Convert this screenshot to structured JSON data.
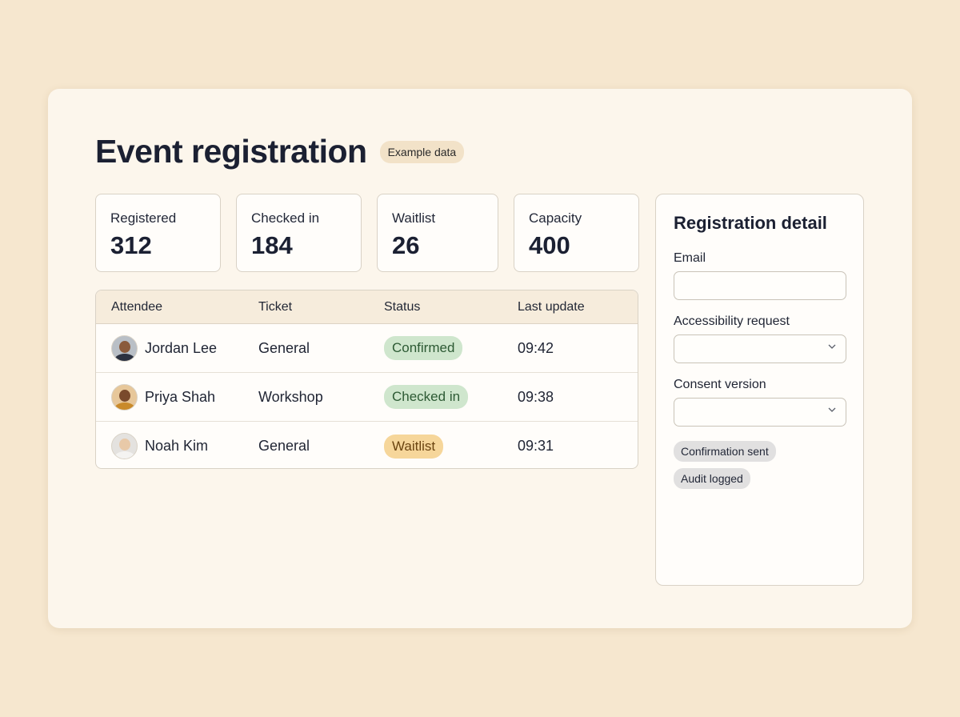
{
  "header": {
    "title": "Event registration",
    "badge": "Example data"
  },
  "stats": [
    {
      "label": "Registered",
      "value": "312"
    },
    {
      "label": "Checked in",
      "value": "184"
    },
    {
      "label": "Waitlist",
      "value": "26"
    },
    {
      "label": "Capacity",
      "value": "400"
    }
  ],
  "table": {
    "columns": [
      "Attendee",
      "Ticket",
      "Status",
      "Last update"
    ],
    "rows": [
      {
        "name": "Jordan Lee",
        "ticket": "General",
        "status": "Confirmed",
        "status_color": "#cfe6cd",
        "updated": "09:42"
      },
      {
        "name": "Priya Shah",
        "ticket": "Workshop",
        "status": "Checked in",
        "status_color": "#cfe6cd",
        "updated": "09:38"
      },
      {
        "name": "Noah Kim",
        "ticket": "General",
        "status": "Waitlist",
        "status_color": "#f6d69a",
        "updated": "09:31"
      }
    ]
  },
  "detail": {
    "title": "Registration detail",
    "email_label": "Email",
    "email_value": "",
    "accessibility_label": "Accessibility request",
    "accessibility_value": "",
    "consent_label": "Consent version",
    "consent_value": "",
    "tags": [
      "Confirmation sent",
      "Audit logged"
    ]
  },
  "icons": {
    "avatar_1": "avatar-jordan-lee",
    "avatar_2": "avatar-priya-shah",
    "avatar_3": "avatar-noah-kim",
    "select_chevron": "chevron-down-icon"
  }
}
